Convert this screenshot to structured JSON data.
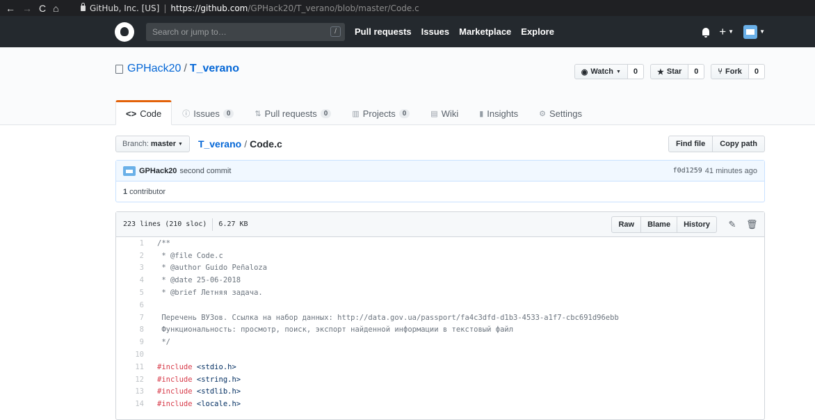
{
  "browser": {
    "org": "GitHub, Inc. [US]",
    "host": "https://github.com",
    "path": "/GPHack20/T_verano/blob/master/Code.c"
  },
  "header": {
    "search_placeholder": "Search or jump to…",
    "slash": "/",
    "nav": [
      "Pull requests",
      "Issues",
      "Marketplace",
      "Explore"
    ],
    "plus": "+"
  },
  "repo": {
    "owner": "GPHack20",
    "sep": "/",
    "name": "T_verano",
    "watch_label": "Watch",
    "watch_count": "0",
    "star_label": "Star",
    "star_count": "0",
    "fork_label": "Fork",
    "fork_count": "0"
  },
  "tabs": [
    {
      "label": "Code"
    },
    {
      "label": "Issues",
      "count": "0"
    },
    {
      "label": "Pull requests",
      "count": "0"
    },
    {
      "label": "Projects",
      "count": "0"
    },
    {
      "label": "Wiki"
    },
    {
      "label": "Insights"
    },
    {
      "label": "Settings"
    }
  ],
  "filenav": {
    "branch_prefix": "Branch:",
    "branch": "master",
    "crumb_repo": "T_verano",
    "crumb_sep": "/",
    "crumb_file": "Code.c",
    "find_file": "Find file",
    "copy_path": "Copy path"
  },
  "commit": {
    "user": "GPHack20",
    "message": "second commit",
    "sha": "f0d1259",
    "time": "41 minutes ago",
    "contributors_count": "1",
    "contributors_label": "contributor"
  },
  "file": {
    "lines": "223 lines (210 sloc)",
    "size": "6.27 KB",
    "raw": "Raw",
    "blame": "Blame",
    "history": "History"
  },
  "code": [
    {
      "n": "1",
      "t": "/**"
    },
    {
      "n": "2",
      "t": " * @file Code.c"
    },
    {
      "n": "3",
      "t": " * @author Guido Peñaloza"
    },
    {
      "n": "4",
      "t": " * @date 25-06-2018"
    },
    {
      "n": "5",
      "t": " * @brief Летняя задача."
    },
    {
      "n": "6",
      "t": ""
    },
    {
      "n": "7",
      "t": " Перечень ВУЗов. Ссылка на набор данных: http://data.gov.ua/passport/fa4c3dfd-d1b3-4533-a1f7-cbc691d96ebb"
    },
    {
      "n": "8",
      "t": " Функциональность: просмотр, поиск, экспорт найденной информации в текстовый файл"
    },
    {
      "n": "9",
      "t": " */"
    },
    {
      "n": "10",
      "t": ""
    },
    {
      "n": "11",
      "kw": "#include",
      "inc": " <stdio.h>"
    },
    {
      "n": "12",
      "kw": "#include",
      "inc": " <string.h>"
    },
    {
      "n": "13",
      "kw": "#include",
      "inc": " <stdlib.h>"
    },
    {
      "n": "14",
      "kw": "#include",
      "inc": " <locale.h>"
    }
  ]
}
